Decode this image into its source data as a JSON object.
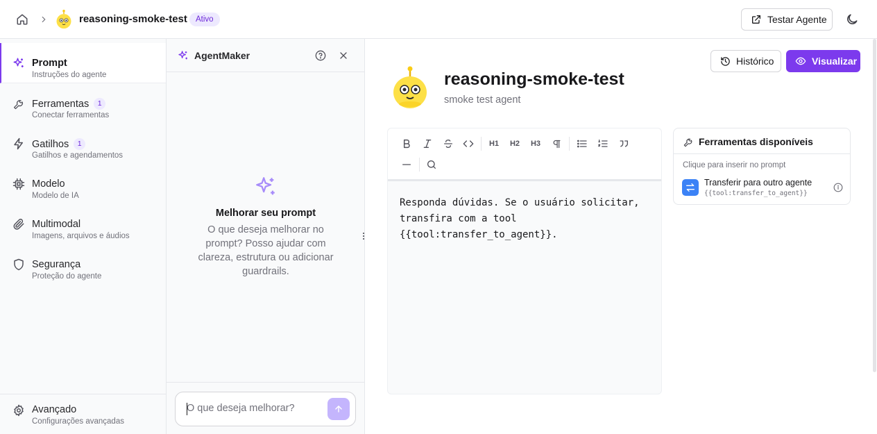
{
  "header": {
    "agent_name": "reasoning-smoke-test",
    "status_badge": "Ativo",
    "test_button": "Testar Agente",
    "icons": [
      "home-icon",
      "chevron-right-icon",
      "robot-avatar-icon",
      "external-link-icon",
      "moon-icon"
    ]
  },
  "sidebar": {
    "items": [
      {
        "label": "Prompt",
        "sub": "Instruções do agente",
        "icon": "sparkles-icon",
        "active": true
      },
      {
        "label": "Ferramentas",
        "sub": "Conectar ferramentas",
        "icon": "wrench-icon",
        "count": "1"
      },
      {
        "label": "Gatilhos",
        "sub": "Gatilhos e agendamentos",
        "icon": "zap-icon",
        "count": "1"
      },
      {
        "label": "Modelo",
        "sub": "Modelo de IA",
        "icon": "cpu-icon"
      },
      {
        "label": "Multimodal",
        "sub": "Imagens, arquivos e áudios",
        "icon": "paperclip-icon"
      },
      {
        "label": "Segurança",
        "sub": "Proteção do agente",
        "icon": "shield-icon"
      }
    ],
    "bottom": {
      "label": "Avançado",
      "sub": "Configurações avançadas",
      "icon": "gear-icon"
    }
  },
  "agentmaker": {
    "title": "AgentMaker",
    "heading": "Melhorar seu prompt",
    "description": "O que deseja melhorar no prompt? Posso ajudar com clareza, estrutura ou adicionar guardrails.",
    "input_placeholder": "O que deseja melhorar?",
    "icons": [
      "sparkles-icon",
      "help-circle-icon",
      "close-icon",
      "arrow-up-icon"
    ]
  },
  "main": {
    "history_button": "Histórico",
    "view_button": "Visualizar",
    "title": "reasoning-smoke-test",
    "subtitle": "smoke test agent",
    "toolbar": [
      "bold-icon",
      "italic-icon",
      "strikethrough-icon",
      "code-icon",
      "heading-1-icon",
      "heading-2-icon",
      "heading-3-icon",
      "paragraph-icon",
      "bullet-list-icon",
      "ordered-list-icon",
      "quote-icon",
      "horizontal-rule-icon",
      "search-icon"
    ],
    "toolbar_text": {
      "h1": "H1",
      "h2": "H2",
      "h3": "H3"
    },
    "prompt_text": "Responda dúvidas. Se o usuário solicitar, transfira com a tool {{tool:transfer_to_agent}}."
  },
  "tools_panel": {
    "title": "Ferramentas disponíveis",
    "hint": "Clique para inserir no prompt",
    "tools": [
      {
        "name": "Transferir para outro agente",
        "code": "{{tool:transfer_to_agent}}",
        "icon": "transfer-icon"
      }
    ]
  },
  "colors": {
    "accent": "#7c3aed",
    "badge_bg": "#ede9fe",
    "tool_blue": "#3b82f6",
    "avatar_yellow": "#fde047"
  }
}
